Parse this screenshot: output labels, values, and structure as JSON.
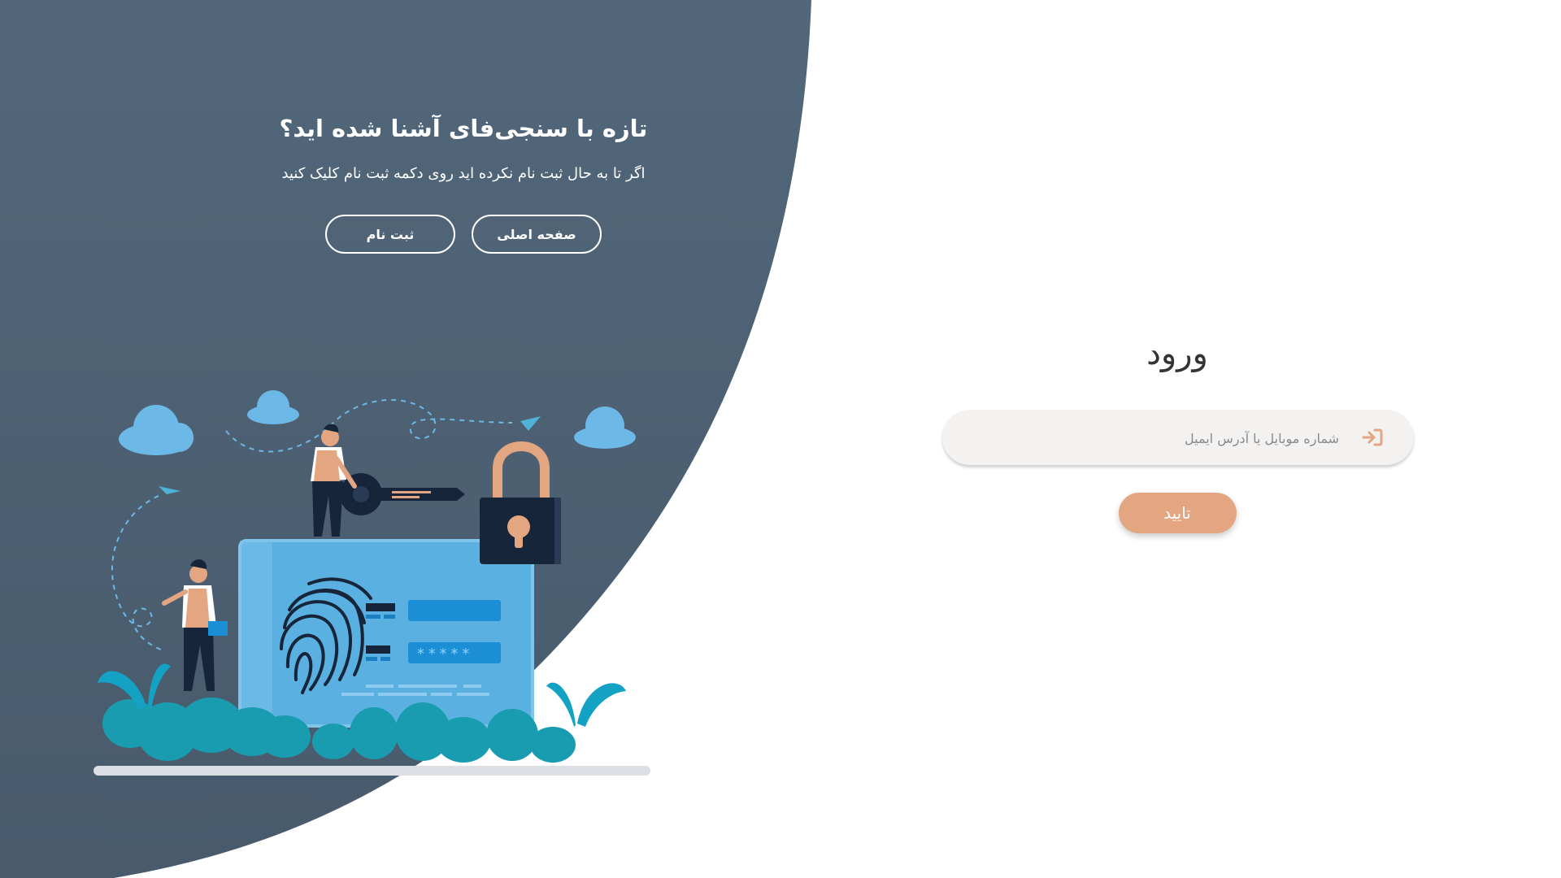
{
  "promo": {
    "title": "تازه با سنجی‌فای آشنا شده اید؟",
    "subtitle": "اگر تا به حال ثبت نام نکرده اید روی دکمه ثبت نام کلیک کنید",
    "home_button": "صفحه اصلی",
    "register_button": "ثبت نام"
  },
  "login": {
    "title": "ورود",
    "input_placeholder": "شماره موبایل یا آدرس ایمیل",
    "input_value": "",
    "submit_button": "تایید",
    "input_icon": "sign-in-icon"
  },
  "illustration": {
    "masked_password": "*****",
    "icons": [
      "cloud-icon",
      "paper-plane-icon",
      "key-icon",
      "padlock-icon",
      "fingerprint-icon",
      "person-icon",
      "plant-icon"
    ]
  },
  "colors": {
    "panel_dark": "#4a5d70",
    "accent": "#e3a681",
    "card_blue": "#5ab0e0",
    "cloud_blue": "#6cb8e6",
    "plant_teal": "#1a9cb0"
  }
}
